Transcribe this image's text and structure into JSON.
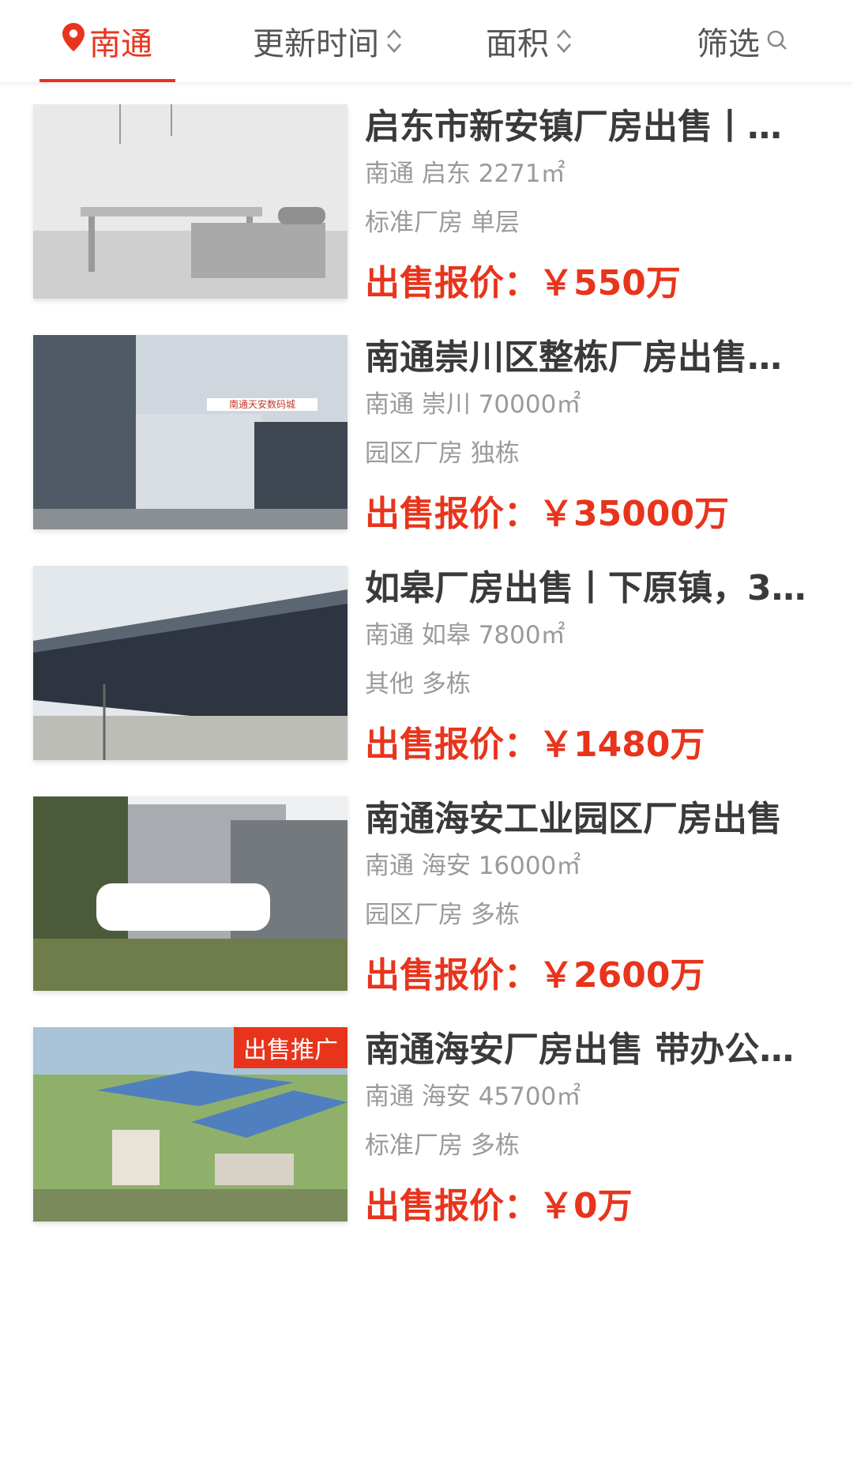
{
  "topbar": {
    "city": "南通",
    "sort_update": "更新时间",
    "sort_area": "面积",
    "filter": "筛选",
    "accent": "#e8341c"
  },
  "listings": [
    {
      "title": "启东市新安镇厂房出售丨…",
      "location": "南通 启东 2271㎡",
      "tags": "标准厂房 单层",
      "price": "出售报价：￥550万",
      "image": "factory-interior"
    },
    {
      "title": "南通崇川区整栋厂房出售…",
      "location": "南通 崇川 70000㎡",
      "tags": "园区厂房 独栋",
      "price": "出售报价：￥35000万",
      "image": "office-buildings",
      "image_sign": "南通天安数码城"
    },
    {
      "title": "如皋厂房出售丨下原镇，3…",
      "location": "南通 如皋 7800㎡",
      "tags": "其他 多栋",
      "price": "出售报价：￥1480万",
      "image": "long-warehouse"
    },
    {
      "title": "南通海安工业园区厂房出售",
      "location": "南通 海安 16000㎡",
      "tags": "园区厂房 多栋",
      "price": "出售报价：￥2600万",
      "image": "factory-building-with-tree"
    },
    {
      "title": "南通海安厂房出售 带办公…",
      "location": "南通 海安 45700㎡",
      "tags": "标准厂房 多栋",
      "price": "出售报价：￥0万",
      "image": "aerial-factory-rendering",
      "badge": "出售推广"
    }
  ]
}
